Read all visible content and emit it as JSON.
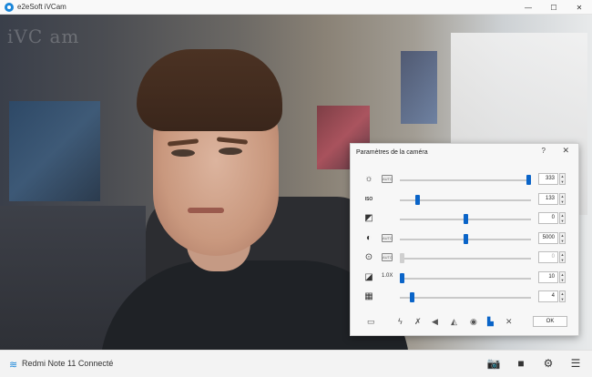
{
  "window": {
    "title": "e2eSoft iVCam",
    "controls": {
      "minimize": "—",
      "maximize": "☐",
      "close": "✕"
    }
  },
  "video": {
    "watermark": "iVC am"
  },
  "dialog": {
    "title": "Paramètres de la caméra",
    "help": "?",
    "close": "✕",
    "rows": [
      {
        "icon": "brightness-icon",
        "glyph": "☼",
        "auto": "AUTO",
        "multiplier": "",
        "value": "333",
        "level": 1.0,
        "enabled": true
      },
      {
        "icon": "iso-icon",
        "glyph": "ISO",
        "auto": "",
        "multiplier": "",
        "value": "133",
        "level": 0.12,
        "enabled": true
      },
      {
        "icon": "exposure-icon",
        "glyph": "◩",
        "auto": "",
        "multiplier": "",
        "value": "0",
        "level": 0.5,
        "enabled": true
      },
      {
        "icon": "white-balance-icon",
        "glyph": "◐",
        "auto": "AUTO",
        "multiplier": "",
        "value": "5000",
        "level": 0.5,
        "enabled": true
      },
      {
        "icon": "focus-icon",
        "glyph": "⊙",
        "auto": "AUTO",
        "multiplier": "",
        "value": "0",
        "level": 0.0,
        "enabled": false
      },
      {
        "icon": "zoom-icon",
        "glyph": "◪",
        "auto": "",
        "multiplier": "1.0X",
        "value": "10",
        "level": 0.0,
        "enabled": true
      },
      {
        "icon": "stabilization-icon",
        "glyph": "▦",
        "auto": "",
        "multiplier": "",
        "value": "4",
        "level": 0.08,
        "enabled": true
      }
    ],
    "spin_up": "▲",
    "spin_down": "▼",
    "toolbar": [
      {
        "name": "battery-icon",
        "glyph": "▭"
      },
      {
        "name": "flash-icon",
        "glyph": "ϟ"
      },
      {
        "name": "flash-off-icon",
        "glyph": "✗"
      },
      {
        "name": "flip-horizontal-icon",
        "glyph": "◀"
      },
      {
        "name": "mirror-icon",
        "glyph": "◭"
      },
      {
        "name": "camera-icon",
        "glyph": "◉"
      },
      {
        "name": "stabilize-icon",
        "glyph": "▙"
      },
      {
        "name": "reset-icon",
        "glyph": "✕"
      }
    ],
    "ok_label": "OK"
  },
  "statusbar": {
    "device": "Redmi Note 11 Connecté",
    "buttons": [
      {
        "name": "snapshot-icon",
        "glyph": "📷"
      },
      {
        "name": "record-icon",
        "glyph": "■"
      },
      {
        "name": "settings-icon",
        "glyph": "⚙"
      },
      {
        "name": "menu-icon",
        "glyph": "☰"
      }
    ]
  },
  "colors": {
    "accent": "#0a64c8",
    "wifi": "#1a86d9"
  }
}
